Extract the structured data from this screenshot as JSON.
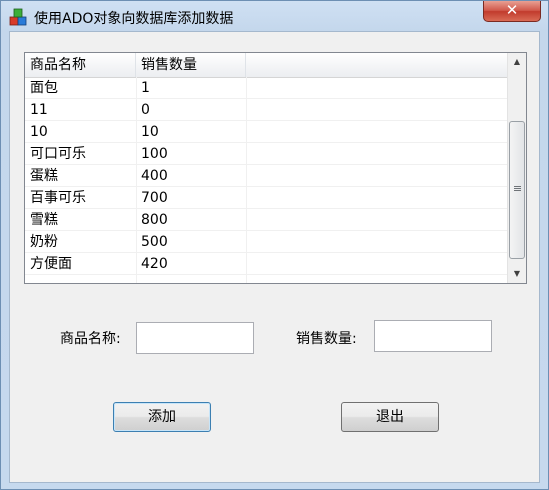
{
  "window": {
    "title": "使用ADO对象向数据库添加数据",
    "close_symbol": "✕",
    "icon": "app-cubes-icon"
  },
  "table": {
    "columns": [
      "商品名称",
      "销售数量"
    ],
    "rows": [
      [
        "面包",
        "1"
      ],
      [
        "11",
        "0"
      ],
      [
        "10",
        "10"
      ],
      [
        "可口可乐",
        "100"
      ],
      [
        "蛋糕",
        "400"
      ],
      [
        "百事可乐",
        "700"
      ],
      [
        "雪糕",
        "800"
      ],
      [
        "奶粉",
        "500"
      ],
      [
        "方便面",
        "420"
      ]
    ],
    "scroll_up_symbol": "▲",
    "scroll_down_symbol": "▼"
  },
  "form": {
    "name_label": "商品名称:",
    "name_value": "",
    "qty_label": "销售数量:",
    "qty_value": ""
  },
  "buttons": {
    "add_label": "添加",
    "exit_label": "退出"
  }
}
